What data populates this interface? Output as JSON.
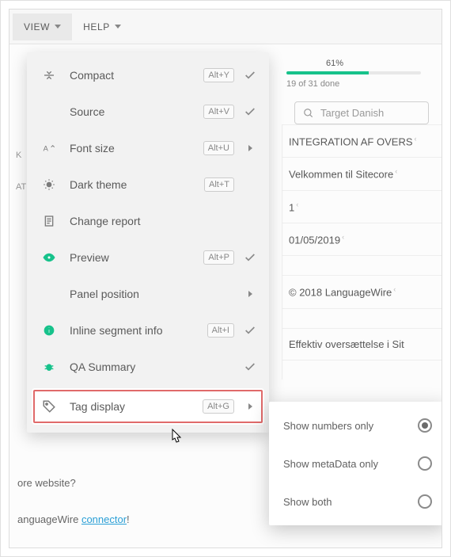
{
  "menubar": {
    "view": "VIEW",
    "help": "HELP"
  },
  "progress": {
    "percent": "61%",
    "fill_pct": 61,
    "status": "19 of 31 done"
  },
  "search": {
    "placeholder": "Target Danish"
  },
  "rows": {
    "r1": "INTEGRATION AF OVERS",
    "r2": "Velkommen til Sitecore",
    "r3": "1",
    "r4": "01/05/2019",
    "r5": "© 2018 LanguageWire",
    "r6": "Effektiv oversættelse i Sit"
  },
  "partial": {
    "website": "ore website?",
    "lw_pre": "anguageWire ",
    "lw_link": "connector",
    "lw_post": "!"
  },
  "side": {
    "k": "K",
    "at": "AT"
  },
  "dropdown": {
    "compact": {
      "label": "Compact",
      "kbd": "Alt+Y"
    },
    "source": {
      "label": "Source",
      "kbd": "Alt+V"
    },
    "fontsize": {
      "label": "Font size",
      "kbd": "Alt+U"
    },
    "dark": {
      "label": "Dark theme",
      "kbd": "Alt+T"
    },
    "report": {
      "label": "Change report"
    },
    "preview": {
      "label": "Preview",
      "kbd": "Alt+P"
    },
    "panel": {
      "label": "Panel position"
    },
    "inline": {
      "label": "Inline segment info",
      "kbd": "Alt+I"
    },
    "qa": {
      "label": "QA Summary"
    },
    "tag": {
      "label": "Tag display",
      "kbd": "Alt+G"
    }
  },
  "submenu": {
    "numbers": "Show numbers only",
    "meta": "Show metaData only",
    "both": "Show both"
  }
}
